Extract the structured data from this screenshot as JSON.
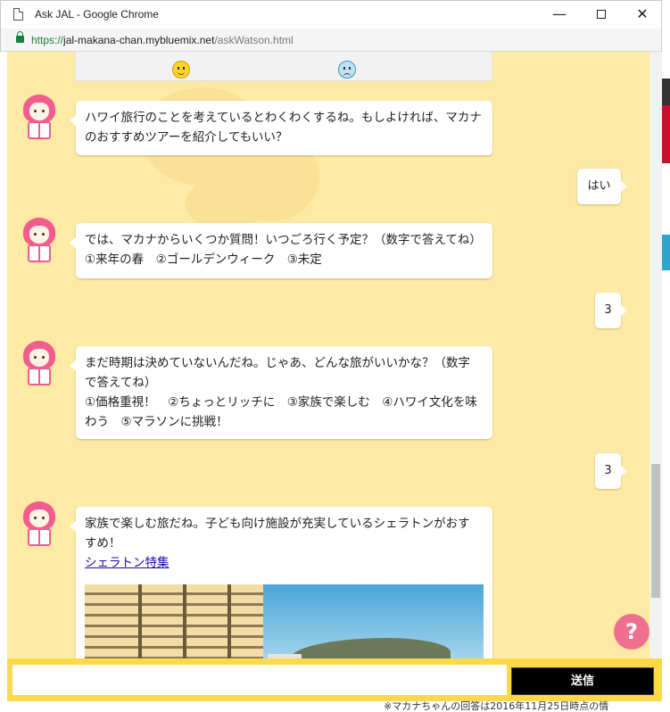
{
  "window": {
    "title": "Ask JAL - Google Chrome",
    "min_glyph": "—",
    "close_glyph": "✕"
  },
  "address": {
    "scheme": "https://",
    "host": "jal-makana-chan.mybluemix.net",
    "path": "/askWatson.html"
  },
  "chat": {
    "messages": [
      {
        "from": "bot",
        "lines": [
          "ハワイ旅行のことを考えているとわくわくするね。もしよければ、マカナ",
          "のおすすめツアーを紹介してもいい？"
        ]
      },
      {
        "from": "user",
        "text": "はい"
      },
      {
        "from": "bot",
        "lines": [
          "では、マカナからいくつか質問！いつごろ行く予定？（数字で答えてね）",
          "①来年の春　②ゴールデンウィーク　③未定"
        ]
      },
      {
        "from": "user",
        "text": "3"
      },
      {
        "from": "bot",
        "lines": [
          "まだ時期は決めていないんだね。じゃあ、どんな旅がいいかな？（数字",
          "で答えてね）",
          "①価格重視！　②ちょっとリッチに　③家族で楽しむ　④ハワイ文化を味",
          "わう　⑤マラソンに挑戦！"
        ]
      },
      {
        "from": "user",
        "text": "3"
      },
      {
        "from": "bot",
        "lines": [
          "家族で楽しむ旅だね。子ども向け施設が充実しているシェラトンがおす",
          "すめ！"
        ],
        "link": "シェラトン特集"
      }
    ]
  },
  "help": {
    "label": "?"
  },
  "input": {
    "value": "",
    "placeholder": ""
  },
  "send": {
    "label": "送信"
  },
  "footer": {
    "note": "※マカナちゃんの回答は2016年11月25日時点の情"
  },
  "colors": {
    "chat_bg": "#fdeaa4",
    "input_bar": "#fbd94a",
    "avatar_pink": "#f25c8e",
    "help_button": "#ef6f8f"
  },
  "icons": [
    "document-icon",
    "lock-icon",
    "smile-icon",
    "sad-icon",
    "makana-avatar-icon"
  ]
}
